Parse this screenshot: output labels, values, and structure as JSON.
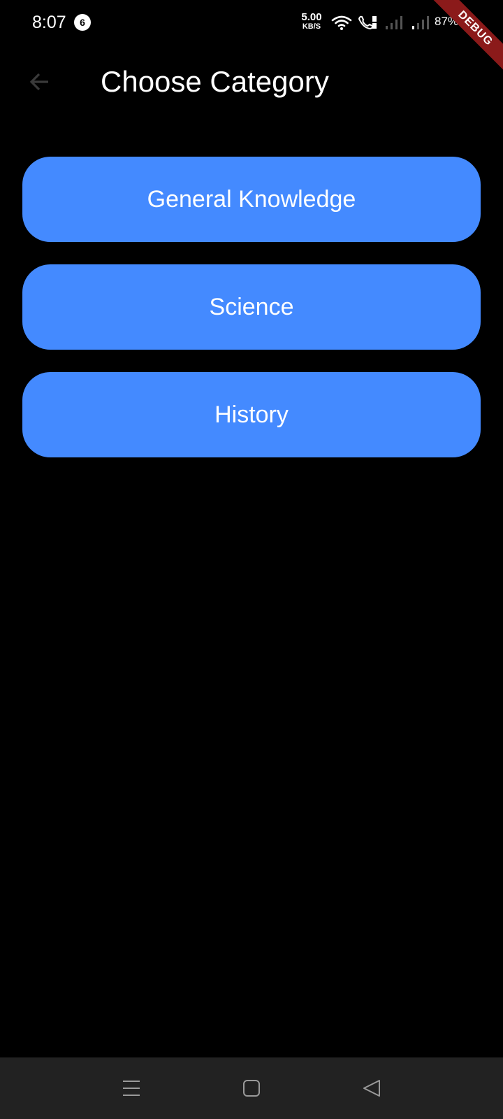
{
  "status_bar": {
    "time": "8:07",
    "notification_count": "6",
    "net_speed_value": "5.00",
    "net_speed_unit": "KB/S",
    "battery": "87%"
  },
  "debug_banner": "DEBUG",
  "app_bar": {
    "title": "Choose Category",
    "back_icon": "arrow-left-icon"
  },
  "categories": [
    {
      "label": "General Knowledge"
    },
    {
      "label": "Science"
    },
    {
      "label": "History"
    }
  ],
  "nav_bar": {
    "icons": [
      "menu-icon",
      "home-icon",
      "back-triangle-icon"
    ]
  },
  "colors": {
    "background": "#000000",
    "button": "#448aff",
    "button_text": "#ffffff",
    "debug_ribbon": "#8b1a1a",
    "nav_bar": "#222222",
    "back_arrow": "#3a3a3a"
  }
}
